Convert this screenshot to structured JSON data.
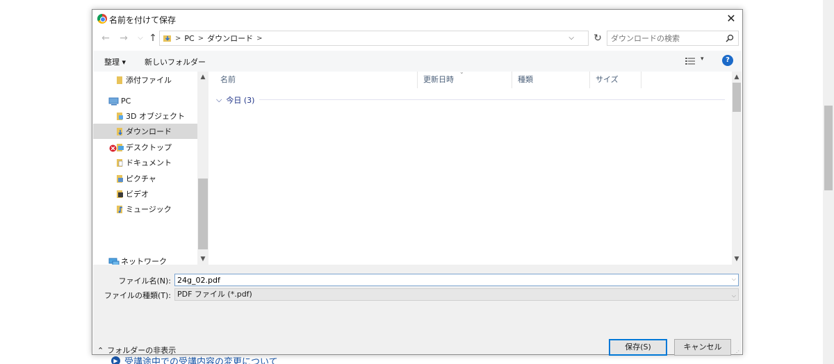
{
  "background": {
    "link_text": "受講途中での受講内容の変更について"
  },
  "dialog": {
    "title": "名前を付けて保存",
    "close_glyph": "✕",
    "nav": {
      "back": "←",
      "forward": "→",
      "recent": "⌵",
      "up": "↑"
    },
    "breadcrumb": [
      "PC",
      "ダウンロード"
    ],
    "breadcrumb_sep": ">",
    "refresh_glyph": "↻",
    "search_placeholder": "ダウンロードの検索",
    "toolbar": {
      "organize": "整理 ▾",
      "new_folder": "新しいフォルダー"
    },
    "nav_pane": [
      {
        "label": "添付ファイル",
        "icon": "folder-icon"
      },
      {
        "label": "PC",
        "icon": "pc-icon"
      },
      {
        "label": "3D オブジェクト",
        "icon": "3d-objects-icon"
      },
      {
        "label": "ダウンロード",
        "icon": "downloads-icon",
        "selected": true
      },
      {
        "label": "デスクトップ",
        "icon": "desktop-icon",
        "error_badge": true
      },
      {
        "label": "ドキュメント",
        "icon": "documents-icon"
      },
      {
        "label": "ピクチャ",
        "icon": "pictures-icon"
      },
      {
        "label": "ビデオ",
        "icon": "videos-icon"
      },
      {
        "label": "ミュージック",
        "icon": "music-icon"
      },
      {
        "label": "ネットワーク",
        "icon": "network-icon"
      }
    ],
    "columns": [
      "名前",
      "更新日時",
      "種類",
      "サイズ"
    ],
    "group": {
      "label": "今日 (3)"
    },
    "filename_label": "ファイル名(N):",
    "filename_value": "24g_02.pdf",
    "filetype_label": "ファイルの種類(T):",
    "filetype_value": "PDF ファイル (*.pdf)",
    "hide_folders": "フォルダーの非表示",
    "save_button": "保存(S)",
    "cancel_button": "キャンセル"
  }
}
